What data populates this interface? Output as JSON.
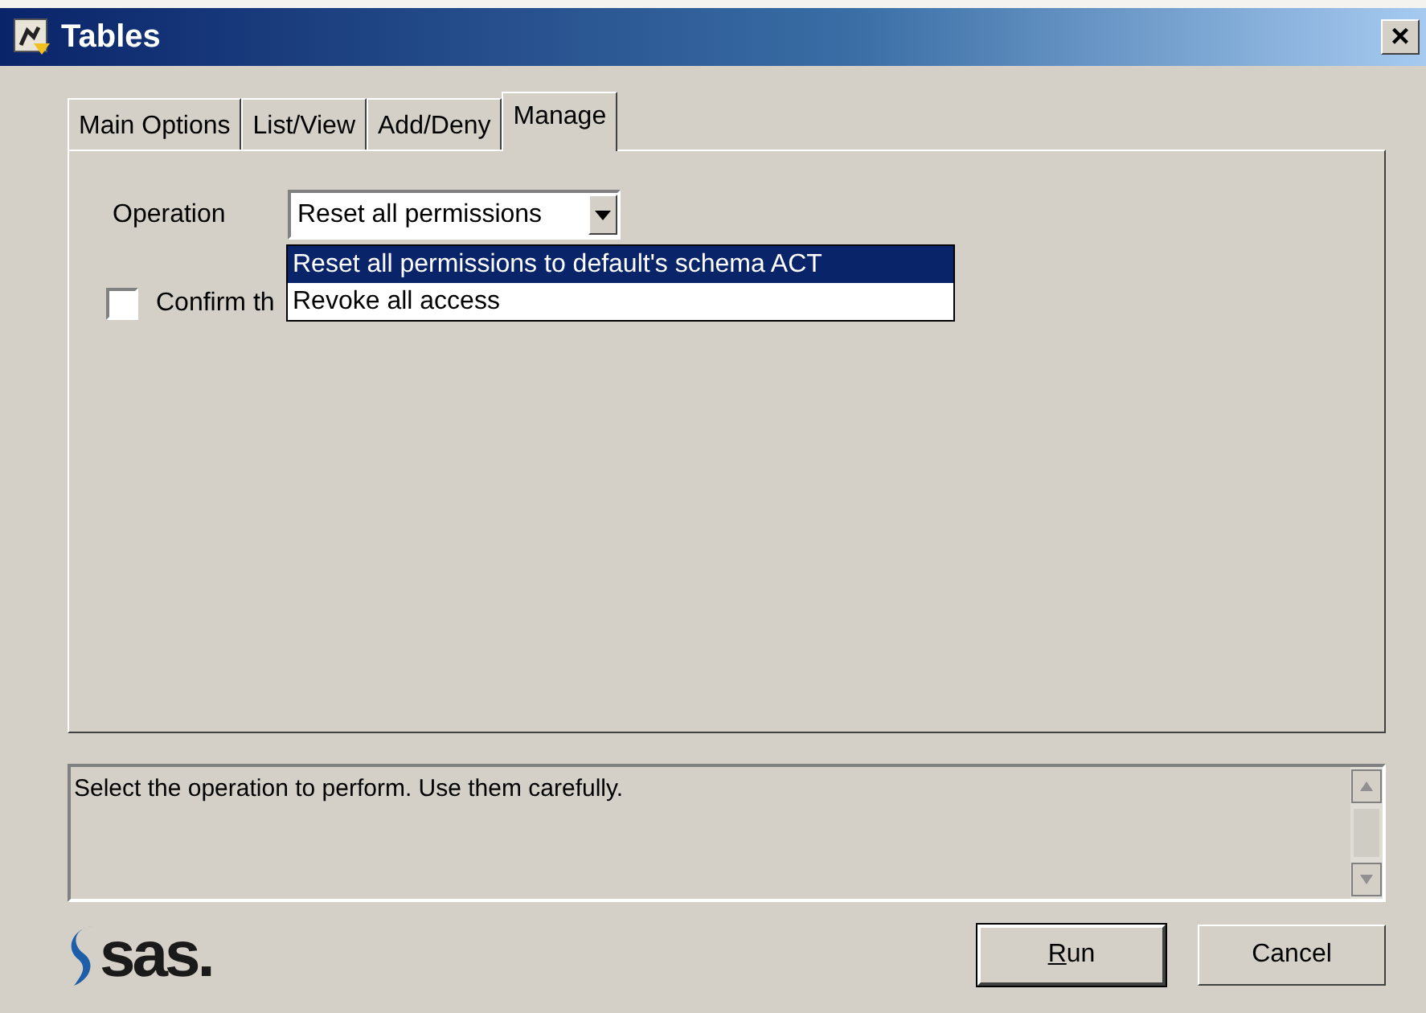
{
  "window": {
    "title": "Tables",
    "close": "×"
  },
  "tabs": [
    {
      "label": "Main Options",
      "selected": false
    },
    {
      "label": "List/View",
      "selected": false
    },
    {
      "label": "Add/Deny",
      "selected": false
    },
    {
      "label": "Manage",
      "selected": true
    }
  ],
  "operation": {
    "label": "Operation",
    "value": "Reset all permissions",
    "expanded": true,
    "options": [
      {
        "label": "Reset all permissions to default's schema ACT",
        "selected": true
      },
      {
        "label": "Revoke all access",
        "selected": false
      }
    ]
  },
  "confirm": {
    "label": "Confirm th",
    "checked": false
  },
  "description": "Select the operation to perform. Use them carefully.",
  "logo": "sas.",
  "buttons": [
    {
      "label": "Run",
      "mnemonic": true,
      "default": true
    },
    {
      "label": "Cancel",
      "default": false
    }
  ]
}
